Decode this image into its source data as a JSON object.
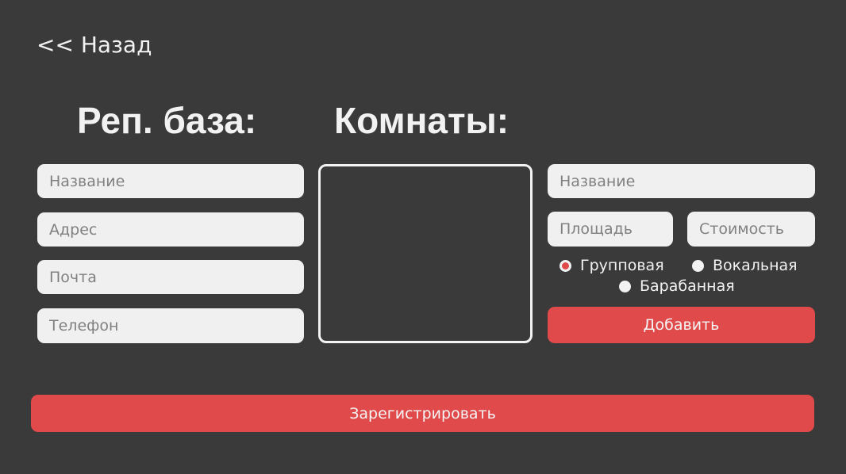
{
  "nav": {
    "back_label": "<< Назад"
  },
  "base_section": {
    "title": "Реп. база:",
    "fields": {
      "name_placeholder": "Название",
      "address_placeholder": "Адрес",
      "email_placeholder": "Почта",
      "phone_placeholder": "Телефон"
    }
  },
  "rooms_section": {
    "title": "Комнаты:",
    "rooms": [],
    "fields": {
      "name_placeholder": "Название",
      "area_placeholder": "Площадь",
      "price_placeholder": "Стоимость"
    },
    "room_types": [
      {
        "label": "Групповая",
        "selected": true
      },
      {
        "label": "Вокальная",
        "selected": false
      },
      {
        "label": "Барабанная",
        "selected": false
      }
    ],
    "add_label": "Добавить"
  },
  "register_label": "Зарегистрировать",
  "colors": {
    "background": "#3a3a3a",
    "accent": "#e04a4a",
    "field": "#f0f0f0",
    "text": "#f2f2f2"
  }
}
